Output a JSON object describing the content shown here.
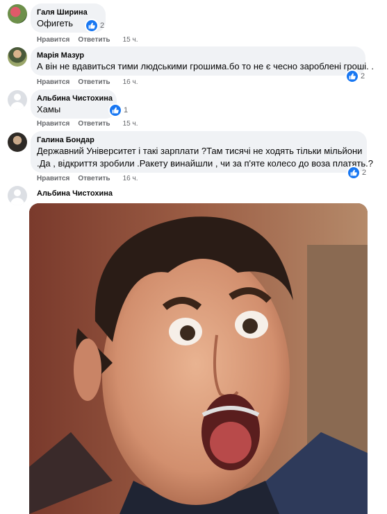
{
  "comments": [
    {
      "author": "Галя Ширина",
      "text": "Офигеть",
      "likes": "2",
      "actions": {
        "like": "Нравится",
        "reply": "Ответить",
        "time": "15 ч."
      }
    },
    {
      "author": "Марія Мазур",
      "text": "А він не вдавиться тими людськими грошима.бо то не є чесно зароблені гроші. .",
      "likes": "2",
      "actions": {
        "like": "Нравится",
        "reply": "Ответить",
        "time": "16 ч."
      }
    },
    {
      "author": "Альбина Чистохина",
      "text": "Хамы",
      "likes": "1",
      "actions": {
        "like": "Нравится",
        "reply": "Ответить",
        "time": "15 ч."
      }
    },
    {
      "author": "Галина Бондар",
      "text_lines": [
        "Державний Університет і такі зарплати ?Там тисячі не ходять тільки мільйони",
        ".Да , відкриття зробили .Ракету винайшли , чи за п'яте колесо до воза платять.?"
      ],
      "likes": "2",
      "actions": {
        "like": "Нравится",
        "reply": "Ответить",
        "time": "16 ч."
      }
    },
    {
      "author": "Альбина Чистохина",
      "attachment": "surprised-face-gif"
    }
  ],
  "colors": {
    "like_blue": "#1877f2",
    "bubble_bg": "#f0f2f5",
    "meta_gray": "#65676b"
  }
}
